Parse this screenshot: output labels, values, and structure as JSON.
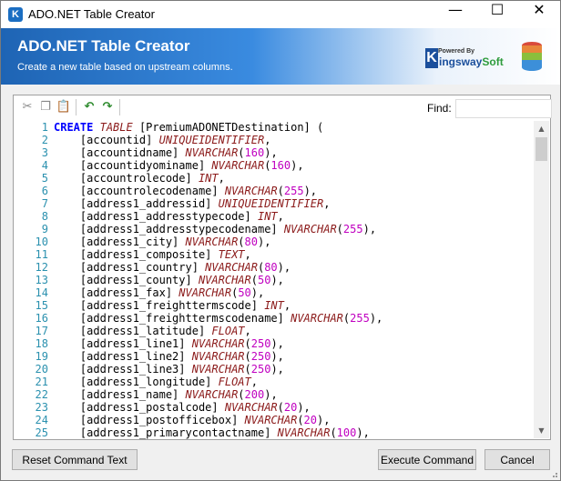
{
  "window": {
    "title": "ADO.NET Table Creator",
    "controls": {
      "minimize": "—",
      "maximize": "☐",
      "close": "✕"
    },
    "app_icon_letter": "K"
  },
  "banner": {
    "title": "ADO.NET Table Creator",
    "subtitle": "Create a new table based on upstream columns.",
    "logo": {
      "small": "Powered By",
      "k": "K",
      "brand_a": "ingsway",
      "brand_b": "Soft"
    }
  },
  "toolbar": {
    "icons": [
      "cut-icon",
      "copy-icon",
      "paste-icon",
      "undo-icon",
      "redo-icon"
    ],
    "find_label": "Find:",
    "find_value": ""
  },
  "editor": {
    "lines": [
      [
        [
          "kw",
          "CREATE"
        ],
        [
          "t",
          " "
        ],
        [
          "kw2",
          "TABLE"
        ],
        [
          "t",
          " [PremiumADONETDestination] ("
        ]
      ],
      [
        [
          "t",
          "    [accountid] "
        ],
        [
          "kw2",
          "UNIQUEIDENTIFIER"
        ],
        [
          "t",
          ","
        ]
      ],
      [
        [
          "t",
          "    [accountidname] "
        ],
        [
          "kw2",
          "NVARCHAR"
        ],
        [
          "t",
          "("
        ],
        [
          "num",
          "160"
        ],
        [
          "t",
          "),"
        ]
      ],
      [
        [
          "t",
          "    [accountidyominame] "
        ],
        [
          "kw2",
          "NVARCHAR"
        ],
        [
          "t",
          "("
        ],
        [
          "num",
          "160"
        ],
        [
          "t",
          "),"
        ]
      ],
      [
        [
          "t",
          "    [accountrolecode] "
        ],
        [
          "kw2",
          "INT"
        ],
        [
          "t",
          ","
        ]
      ],
      [
        [
          "t",
          "    [accountrolecodename] "
        ],
        [
          "kw2",
          "NVARCHAR"
        ],
        [
          "t",
          "("
        ],
        [
          "num",
          "255"
        ],
        [
          "t",
          "),"
        ]
      ],
      [
        [
          "t",
          "    [address1_addressid] "
        ],
        [
          "kw2",
          "UNIQUEIDENTIFIER"
        ],
        [
          "t",
          ","
        ]
      ],
      [
        [
          "t",
          "    [address1_addresstypecode] "
        ],
        [
          "kw2",
          "INT"
        ],
        [
          "t",
          ","
        ]
      ],
      [
        [
          "t",
          "    [address1_addresstypecodename] "
        ],
        [
          "kw2",
          "NVARCHAR"
        ],
        [
          "t",
          "("
        ],
        [
          "num",
          "255"
        ],
        [
          "t",
          "),"
        ]
      ],
      [
        [
          "t",
          "    [address1_city] "
        ],
        [
          "kw2",
          "NVARCHAR"
        ],
        [
          "t",
          "("
        ],
        [
          "num",
          "80"
        ],
        [
          "t",
          "),"
        ]
      ],
      [
        [
          "t",
          "    [address1_composite] "
        ],
        [
          "kw2",
          "TEXT"
        ],
        [
          "t",
          ","
        ]
      ],
      [
        [
          "t",
          "    [address1_country] "
        ],
        [
          "kw2",
          "NVARCHAR"
        ],
        [
          "t",
          "("
        ],
        [
          "num",
          "80"
        ],
        [
          "t",
          "),"
        ]
      ],
      [
        [
          "t",
          "    [address1_county] "
        ],
        [
          "kw2",
          "NVARCHAR"
        ],
        [
          "t",
          "("
        ],
        [
          "num",
          "50"
        ],
        [
          "t",
          "),"
        ]
      ],
      [
        [
          "t",
          "    [address1_fax] "
        ],
        [
          "kw2",
          "NVARCHAR"
        ],
        [
          "t",
          "("
        ],
        [
          "num",
          "50"
        ],
        [
          "t",
          "),"
        ]
      ],
      [
        [
          "t",
          "    [address1_freighttermscode] "
        ],
        [
          "kw2",
          "INT"
        ],
        [
          "t",
          ","
        ]
      ],
      [
        [
          "t",
          "    [address1_freighttermscodename] "
        ],
        [
          "kw2",
          "NVARCHAR"
        ],
        [
          "t",
          "("
        ],
        [
          "num",
          "255"
        ],
        [
          "t",
          "),"
        ]
      ],
      [
        [
          "t",
          "    [address1_latitude] "
        ],
        [
          "kw2",
          "FLOAT"
        ],
        [
          "t",
          ","
        ]
      ],
      [
        [
          "t",
          "    [address1_line1] "
        ],
        [
          "kw2",
          "NVARCHAR"
        ],
        [
          "t",
          "("
        ],
        [
          "num",
          "250"
        ],
        [
          "t",
          "),"
        ]
      ],
      [
        [
          "t",
          "    [address1_line2] "
        ],
        [
          "kw2",
          "NVARCHAR"
        ],
        [
          "t",
          "("
        ],
        [
          "num",
          "250"
        ],
        [
          "t",
          "),"
        ]
      ],
      [
        [
          "t",
          "    [address1_line3] "
        ],
        [
          "kw2",
          "NVARCHAR"
        ],
        [
          "t",
          "("
        ],
        [
          "num",
          "250"
        ],
        [
          "t",
          "),"
        ]
      ],
      [
        [
          "t",
          "    [address1_longitude] "
        ],
        [
          "kw2",
          "FLOAT"
        ],
        [
          "t",
          ","
        ]
      ],
      [
        [
          "t",
          "    [address1_name] "
        ],
        [
          "kw2",
          "NVARCHAR"
        ],
        [
          "t",
          "("
        ],
        [
          "num",
          "200"
        ],
        [
          "t",
          "),"
        ]
      ],
      [
        [
          "t",
          "    [address1_postalcode] "
        ],
        [
          "kw2",
          "NVARCHAR"
        ],
        [
          "t",
          "("
        ],
        [
          "num",
          "20"
        ],
        [
          "t",
          "),"
        ]
      ],
      [
        [
          "t",
          "    [address1_postofficebox] "
        ],
        [
          "kw2",
          "NVARCHAR"
        ],
        [
          "t",
          "("
        ],
        [
          "num",
          "20"
        ],
        [
          "t",
          "),"
        ]
      ],
      [
        [
          "t",
          "    [address1_primarycontactname] "
        ],
        [
          "kw2",
          "NVARCHAR"
        ],
        [
          "t",
          "("
        ],
        [
          "num",
          "100"
        ],
        [
          "t",
          "),"
        ]
      ]
    ]
  },
  "scrollbar": {
    "up": "▲",
    "down": "▼"
  },
  "buttons": {
    "reset": "Reset Command Text",
    "execute": "Execute Command",
    "cancel": "Cancel"
  },
  "colors": {
    "keyword": "#0000ff",
    "type": "#8b1a1a",
    "number": "#c000c0",
    "line_number": "#2b91af",
    "banner_blue": "#1e64b4"
  }
}
